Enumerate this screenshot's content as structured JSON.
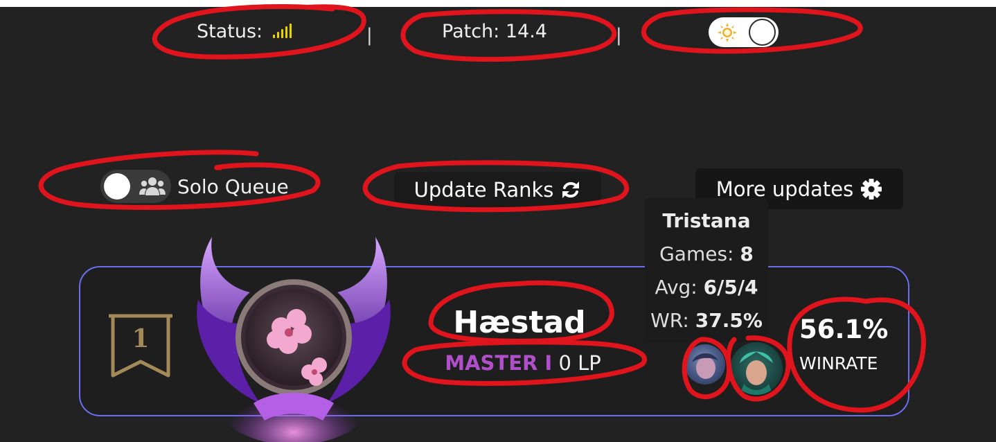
{
  "header": {
    "status_label": "Status:",
    "signal_icon": "signal-bars-icon",
    "separator": "|",
    "patch_label": "Patch: 14.4",
    "theme_toggle_icon": "sun-icon"
  },
  "controls": {
    "queue_toggle_icon": "users-icon",
    "queue_label": "Solo Queue",
    "update_button_label": "Update Ranks",
    "update_icon": "refresh-icon",
    "more_button_label": "More updates",
    "more_icon": "gear-icon"
  },
  "tooltip": {
    "champion": "Tristana",
    "games_label": "Games: ",
    "games_value": "8",
    "avg_label": "Avg: ",
    "avg_value": "6/5/4",
    "wr_label": "WR: ",
    "wr_value": "37.5%"
  },
  "player": {
    "position": "1",
    "name": "Hæstad",
    "tier": "MASTER I",
    "lp": "0 LP",
    "winrate": "56.1%",
    "winrate_label": "WINRATE",
    "emblem_icon": "master-rank-emblem",
    "champion_icons": [
      "champion-portrait-icon",
      "champion-portrait-icon"
    ]
  },
  "colors": {
    "background": "#222222",
    "card_border": "#6a6ff0",
    "tier_color": "#b04fc9",
    "annotation": "#e0141c",
    "signal": "#e9d300"
  }
}
